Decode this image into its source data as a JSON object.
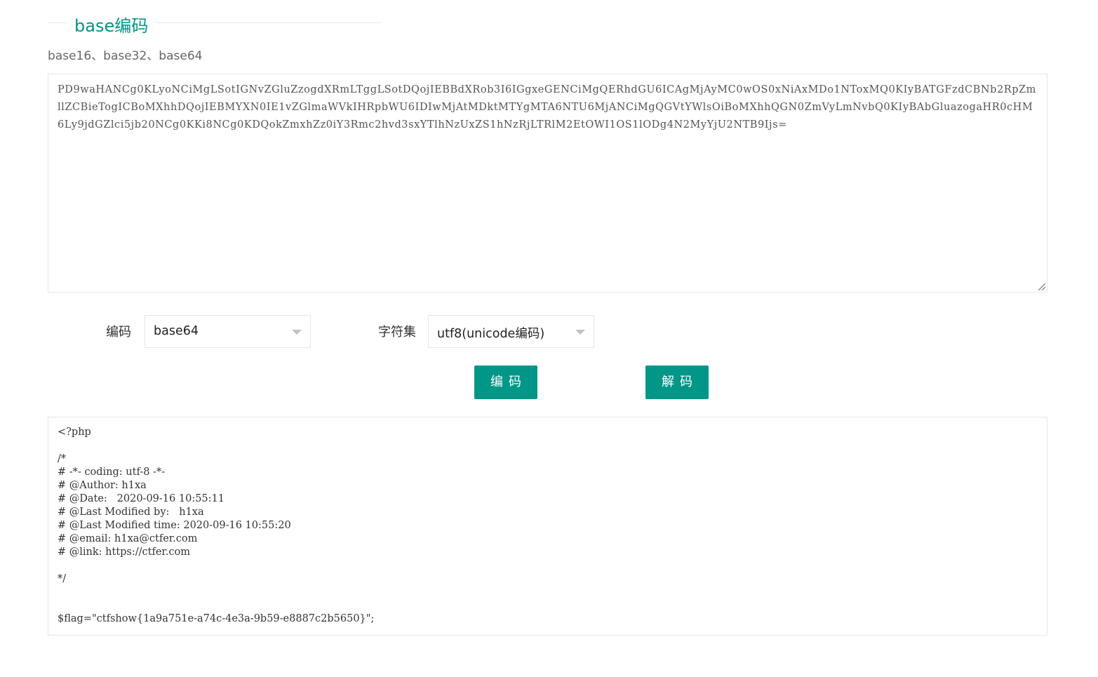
{
  "section": {
    "title": "base编码",
    "subtitle": "base16、base32、base64"
  },
  "input": {
    "value": "PD9waHANCg0KLyoNCiMgLSotIGNvZGluZzogdXRmLTggLSotDQojIEBBdXRob3I6IGgxeGENCiMgQERhdGU6ICAgMjAyMC0wOS0xNiAxMDo1NToxMQ0KIyBATGFzdCBNb2RpZmllZCBieTogICBoMXhhDQojIEBMYXN0IE1vZGlmaWVkIHRpbWU6IDIwMjAtMDktMTYgMTA6NTU6MjANCiMgQGVtYWlsOiBoMXhhQGN0ZmVyLmNvbQ0KIyBAbGluazogaHR0cHM6Ly9jdGZlci5jb20NCg0KKi8NCg0KDQokZmxhZz0iY3Rmc2hvd3sxYTlhNzUxZS1hNzRjLTRlM2EtOWI1OS1lODg4N2MyYjU2NTB9Ijs="
  },
  "form": {
    "encoding_label": "编码",
    "encoding_value": "base64",
    "charset_label": "字符集",
    "charset_value": "utf8(unicode编码)",
    "encode_button": "编码",
    "decode_button": "解码"
  },
  "output": {
    "value": "<?php\n\n/*\n# -*- coding: utf-8 -*-\n# @Author: h1xa\n# @Date:   2020-09-16 10:55:11\n# @Last Modified by:   h1xa\n# @Last Modified time: 2020-09-16 10:55:20\n# @email: h1xa@ctfer.com\n# @link: https://ctfer.com\n\n*/\n\n\n$flag=\"ctfshow{1a9a751e-a74c-4e3a-9b59-e8887c2b5650}\";"
  },
  "colors": {
    "accent": "#009688",
    "border": "#e6e6e6"
  },
  "icons": {
    "select_caret": "caret-down-icon",
    "textarea_grip": "resize-grip-icon"
  }
}
